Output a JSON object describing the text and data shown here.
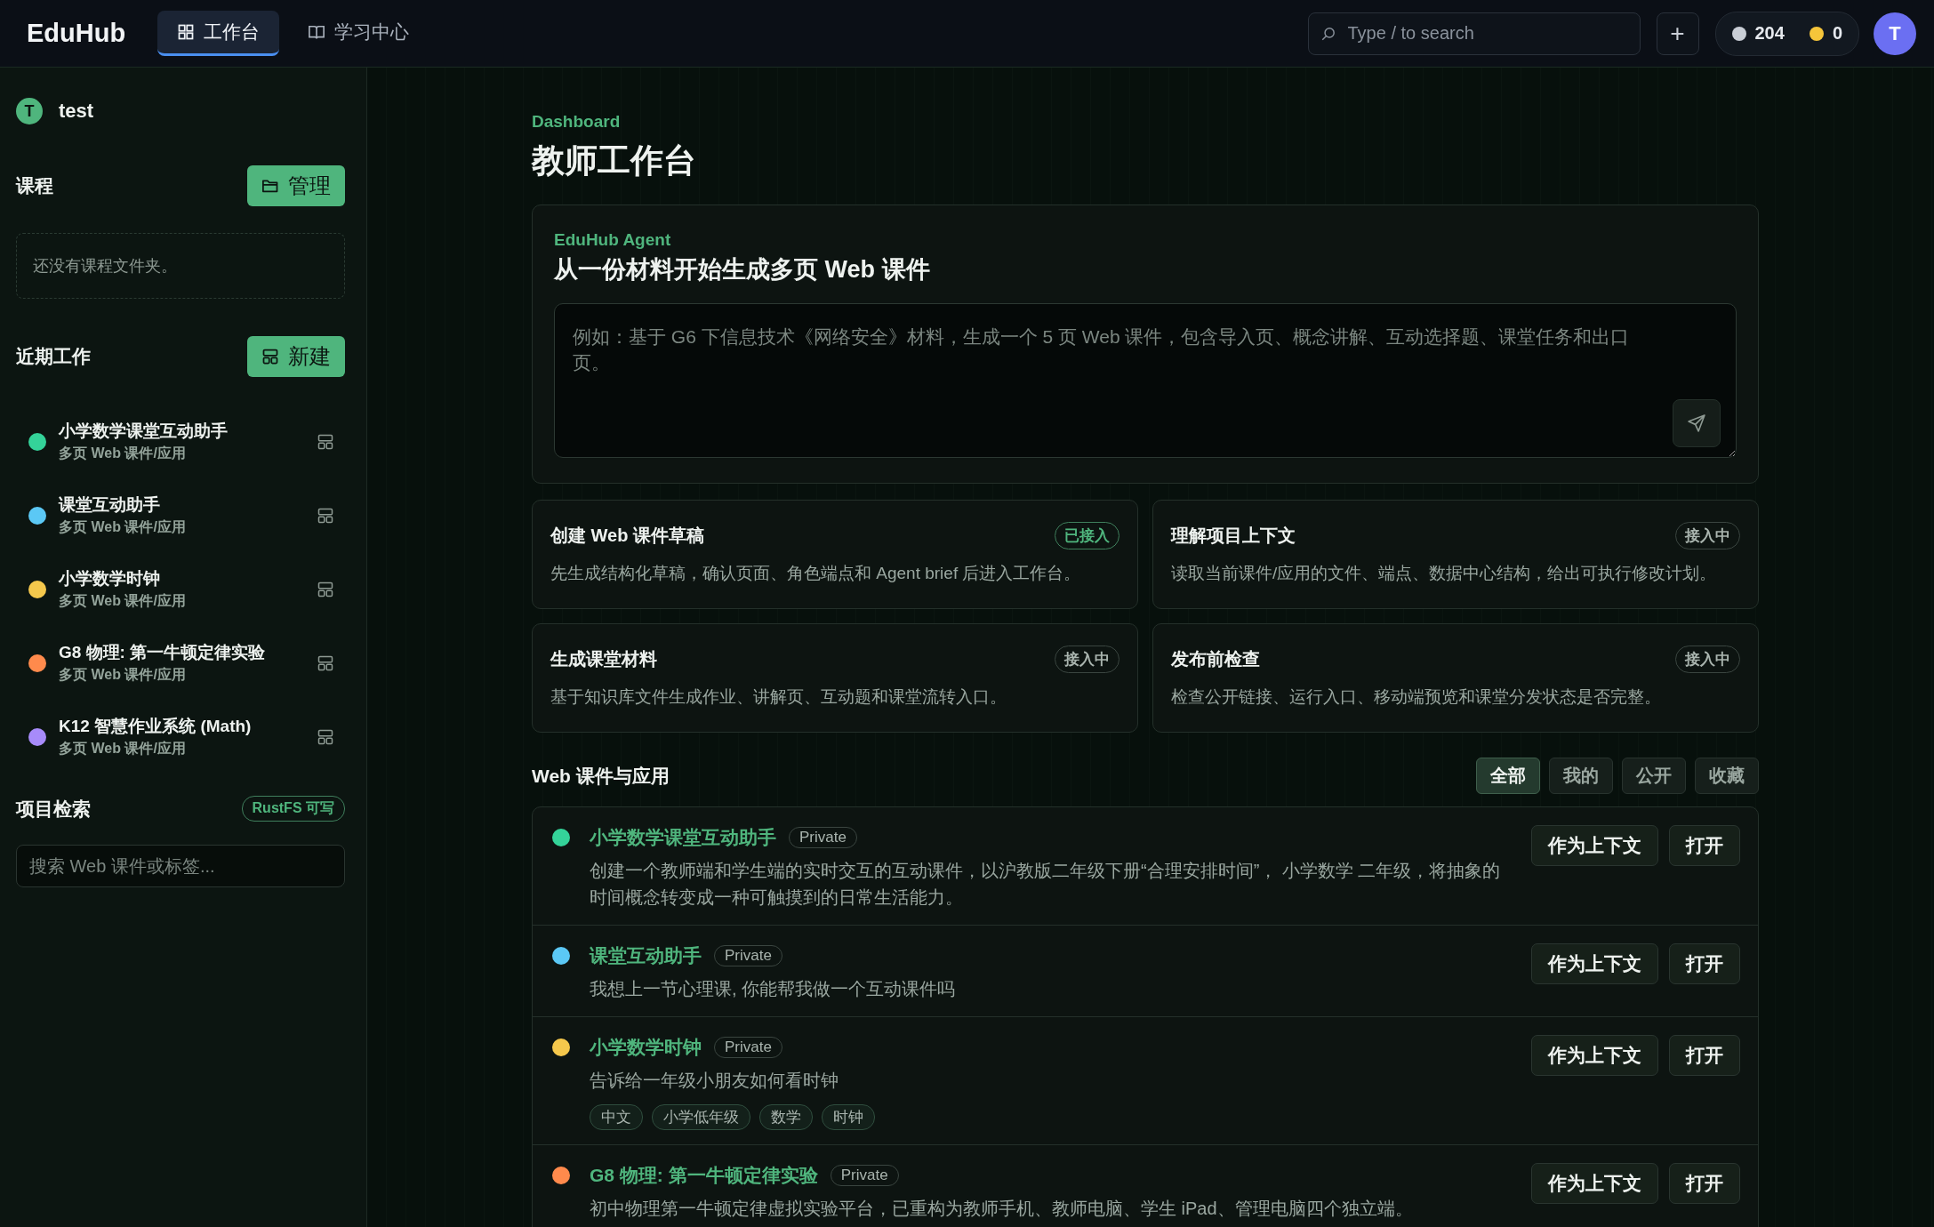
{
  "topbar": {
    "logo": "EduHub",
    "tabs": [
      {
        "label": "工作台",
        "kind": "grid",
        "selected": true
      },
      {
        "label": "学习中心",
        "kind": "book",
        "selected": false
      }
    ],
    "search": {
      "placeholder": "Type / to search"
    },
    "add_button": "+",
    "stats": [
      {
        "value": "204",
        "color": "#c9ced6"
      },
      {
        "value": "0",
        "color": "#f5c53a"
      }
    ],
    "avatar": "T"
  },
  "sidebar": {
    "user": {
      "initial": "T",
      "name": "test"
    },
    "courses": {
      "title": "课程",
      "button": "管理",
      "empty_text": "还没有课程文件夹。"
    },
    "recent": {
      "title": "近期工作",
      "button": "新建",
      "items": [
        {
          "title": "小学数学课堂互动助手",
          "subtitle": "多页 Web 课件/应用",
          "color": "#34d399"
        },
        {
          "title": "课堂互动助手",
          "subtitle": "多页 Web 课件/应用",
          "color": "#5bc8f5"
        },
        {
          "title": "小学数学时钟",
          "subtitle": "多页 Web 课件/应用",
          "color": "#f5c84c"
        },
        {
          "title": "G8 物理: 第一牛顿定律实验",
          "subtitle": "多页 Web 课件/应用",
          "color": "#ff8a4c"
        },
        {
          "title": "K12 智慧作业系统 (Math)",
          "subtitle": "多页 Web 课件/应用",
          "color": "#a78bfa"
        }
      ]
    },
    "project_search": {
      "title": "项目检索",
      "badge": "RustFS 可写",
      "placeholder": "搜索 Web 课件或标签..."
    }
  },
  "main": {
    "eyebrow": "Dashboard",
    "title": "教师工作台",
    "agent": {
      "eyebrow": "EduHub Agent",
      "title": "从一份材料开始生成多页 Web 课件",
      "placeholder": "例如：基于 G6 下信息技术《网络安全》材料，生成一个 5 页 Web 课件，包含导入页、概念讲解、互动选择题、课堂任务和出口页。"
    },
    "capabilities": [
      {
        "title": "创建 Web 课件草稿",
        "status": "已接入",
        "connected": true,
        "description": "先生成结构化草稿，确认页面、角色端点和 Agent brief 后进入工作台。"
      },
      {
        "title": "理解项目上下文",
        "status": "接入中",
        "connected": false,
        "description": "读取当前课件/应用的文件、端点、数据中心结构，给出可执行修改计划。"
      },
      {
        "title": "生成课堂材料",
        "status": "接入中",
        "connected": false,
        "description": "基于知识库文件生成作业、讲解页、互动题和课堂流转入口。"
      },
      {
        "title": "发布前检查",
        "status": "接入中",
        "connected": false,
        "description": "检查公开链接、运行入口、移动端预览和课堂分发状态是否完整。"
      }
    ],
    "apps": {
      "title": "Web 课件与应用",
      "filters": [
        {
          "label": "全部",
          "selected": true
        },
        {
          "label": "我的",
          "selected": false
        },
        {
          "label": "公开",
          "selected": false
        },
        {
          "label": "收藏",
          "selected": false
        }
      ],
      "items": [
        {
          "title": "小学数学课堂互动助手",
          "visibility": "Private",
          "color": "#34d399",
          "description": "创建一个教师端和学生端的实时交互的互动课件，以沪教版二年级下册“合理安排时间”， 小学数学 二年级，将抽象的时间概念转变成一种可触摸到的日常生活能力。",
          "actions": [
            "作为上下文",
            "打开"
          ]
        },
        {
          "title": "课堂互动助手",
          "visibility": "Private",
          "color": "#5bc8f5",
          "description": "我想上一节心理课, 你能帮我做一个互动课件吗",
          "actions": [
            "作为上下文",
            "打开"
          ]
        },
        {
          "title": "小学数学时钟",
          "visibility": "Private",
          "color": "#f5c84c",
          "description": "告诉给一年级小朋友如何看时钟",
          "tags": [
            "中文",
            "小学低年级",
            "数学",
            "时钟"
          ],
          "actions": [
            "作为上下文",
            "打开"
          ]
        },
        {
          "title": "G8 物理: 第一牛顿定律实验",
          "visibility": "Private",
          "color": "#ff8a4c",
          "description": "初中物理第一牛顿定律虚拟实验平台，已重构为教师手机、教师电脑、学生 iPad、管理电脑四个独立端。",
          "actions": [
            "作为上下文",
            "打开"
          ]
        }
      ]
    }
  }
}
